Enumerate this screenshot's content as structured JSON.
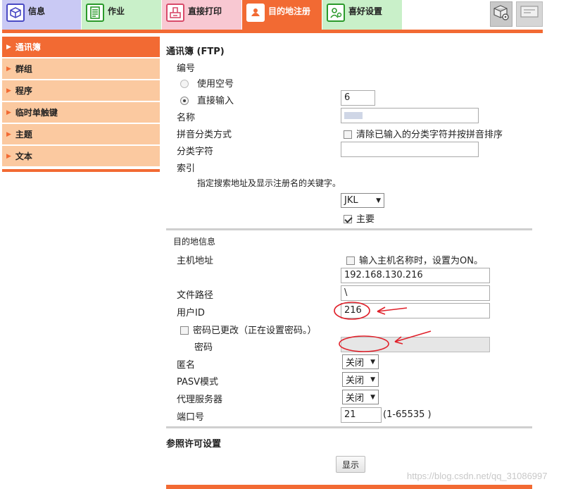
{
  "tabs": [
    {
      "label": "信息",
      "icon": "info-cube-icon"
    },
    {
      "label": "作业",
      "icon": "job-document-icon"
    },
    {
      "label": "直接打印",
      "icon": "direct-print-icon"
    },
    {
      "label": "目的地注册",
      "icon": "destination-register-icon"
    },
    {
      "label": "喜好设置",
      "icon": "preference-user-icon"
    }
  ],
  "sidebar": {
    "items": [
      {
        "label": "通讯簿",
        "active": true
      },
      {
        "label": "群组"
      },
      {
        "label": "程序"
      },
      {
        "label": "临时单触键"
      },
      {
        "label": "主题"
      },
      {
        "label": "文本"
      }
    ]
  },
  "form": {
    "title": "通讯簿 (FTP)",
    "number_label": "编号",
    "use_empty_label": "使用空号",
    "direct_input_label": "直接输入",
    "number_value": "6",
    "name_label": "名称",
    "name_value": "",
    "pinyin_label": "拼音分类方式",
    "pinyin_clear_label": "清除已输入的分类字符并按拼音排序",
    "category_label": "分类字符",
    "category_value": "",
    "index_label": "索引",
    "index_hint": "指定搜索地址及显示注册名的关键字。",
    "index_value": "JKL",
    "primary_label": "主要",
    "dest_info_label": "目的地信息",
    "host_label": "主机地址",
    "host_on_label": "输入主机名称时，设置为ON。",
    "host_value": "192.168.130.216",
    "path_label": "文件路径",
    "path_value": "\\",
    "userid_label": "用户ID",
    "userid_value": "216",
    "pwd_changed_label": "密码已更改（正在设置密码。）",
    "pwd_label": "密码",
    "pwd_value": "",
    "anon_label": "匿名",
    "anon_value": "关闭",
    "pasv_label": "PASV模式",
    "pasv_value": "关闭",
    "proxy_label": "代理服务器",
    "proxy_value": "关闭",
    "port_label": "端口号",
    "port_value": "21",
    "port_range": "(1-65535 )",
    "ref_label": "参照许可设置",
    "show_button": "显示"
  },
  "watermark": "https://blog.csdn.net/qq_31086997",
  "colors": {
    "accent": "#f26a33",
    "sidebar": "#fbc9a0",
    "annotation": "#e0202a"
  }
}
